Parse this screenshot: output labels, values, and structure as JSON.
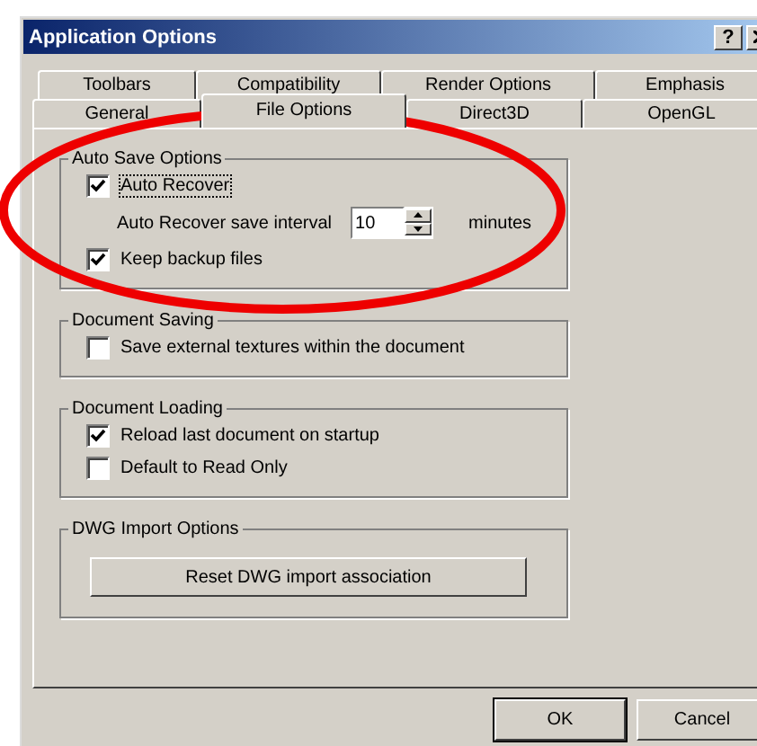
{
  "window": {
    "title": "Application Options",
    "help_button": "?"
  },
  "tab_rows": [
    {
      "tabs": [
        {
          "label": "Toolbars",
          "selected": false
        },
        {
          "label": "Compatibility",
          "selected": false
        },
        {
          "label": "Render Options",
          "selected": false
        },
        {
          "label": "Emphasis",
          "selected": false
        }
      ]
    },
    {
      "tabs": [
        {
          "label": "General",
          "selected": false
        },
        {
          "label": "File Options",
          "selected": true
        },
        {
          "label": "Direct3D",
          "selected": false
        },
        {
          "label": "OpenGL",
          "selected": false
        }
      ]
    }
  ],
  "groups": [
    {
      "title": "Auto Save Options",
      "items": [
        {
          "kind": "checkbox",
          "label": "Auto Recover",
          "checked": true,
          "focused": true
        },
        {
          "kind": "spin",
          "label": "Auto Recover save interval",
          "value": "10",
          "unit": "minutes"
        },
        {
          "kind": "checkbox",
          "label": "Keep backup files",
          "checked": true
        }
      ]
    },
    {
      "title": "Document Saving",
      "items": [
        {
          "kind": "checkbox",
          "label": "Save external textures within the document",
          "checked": false
        }
      ]
    },
    {
      "title": "Document Loading",
      "items": [
        {
          "kind": "checkbox",
          "label": "Reload last document on startup",
          "checked": true
        },
        {
          "kind": "checkbox",
          "label": "Default to Read Only",
          "checked": false
        }
      ]
    },
    {
      "title": "DWG Import Options",
      "items": [
        {
          "kind": "button",
          "label": "Reset DWG import association"
        }
      ]
    }
  ],
  "buttons": [
    {
      "label": "OK",
      "default": true
    },
    {
      "label": "Cancel",
      "default": false
    }
  ]
}
